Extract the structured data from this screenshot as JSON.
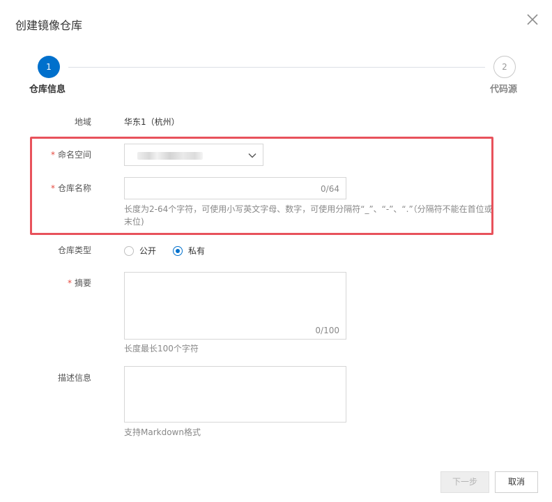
{
  "dialog": {
    "title": "创建镜像仓库",
    "close_icon": "close-icon"
  },
  "steps": [
    {
      "number": "1",
      "label": "仓库信息",
      "state": "active"
    },
    {
      "number": "2",
      "label": "代码源",
      "state": "pending"
    }
  ],
  "form": {
    "region": {
      "label": "地域",
      "value": "华东1（杭州）"
    },
    "namespace": {
      "label": "命名空间",
      "required": "*",
      "value_state": "blurred",
      "icon": "chevron-down-icon"
    },
    "repo_name": {
      "label": "仓库名称",
      "required": "*",
      "value": "",
      "counter": "0/64",
      "help": "长度为2-64个字符，可使用小写英文字母、数字，可使用分隔符“_”、“-”、“.”（分隔符不能在首位或末位)"
    },
    "repo_type": {
      "label": "仓库类型",
      "options": [
        {
          "label": "公开",
          "checked": false
        },
        {
          "label": "私有",
          "checked": true
        }
      ]
    },
    "summary": {
      "label": "摘要",
      "required": "*",
      "value": "",
      "counter": "0/100",
      "help": "长度最长100个字符"
    },
    "description": {
      "label": "描述信息",
      "value": "",
      "help": "支持Markdown格式"
    }
  },
  "footer": {
    "next_label": "下一步",
    "cancel_label": "取消"
  },
  "colors": {
    "primary": "#0070cc",
    "required": "#e64b40",
    "highlight_border": "#e8525b",
    "disabled_bg": "#eeeeee"
  }
}
